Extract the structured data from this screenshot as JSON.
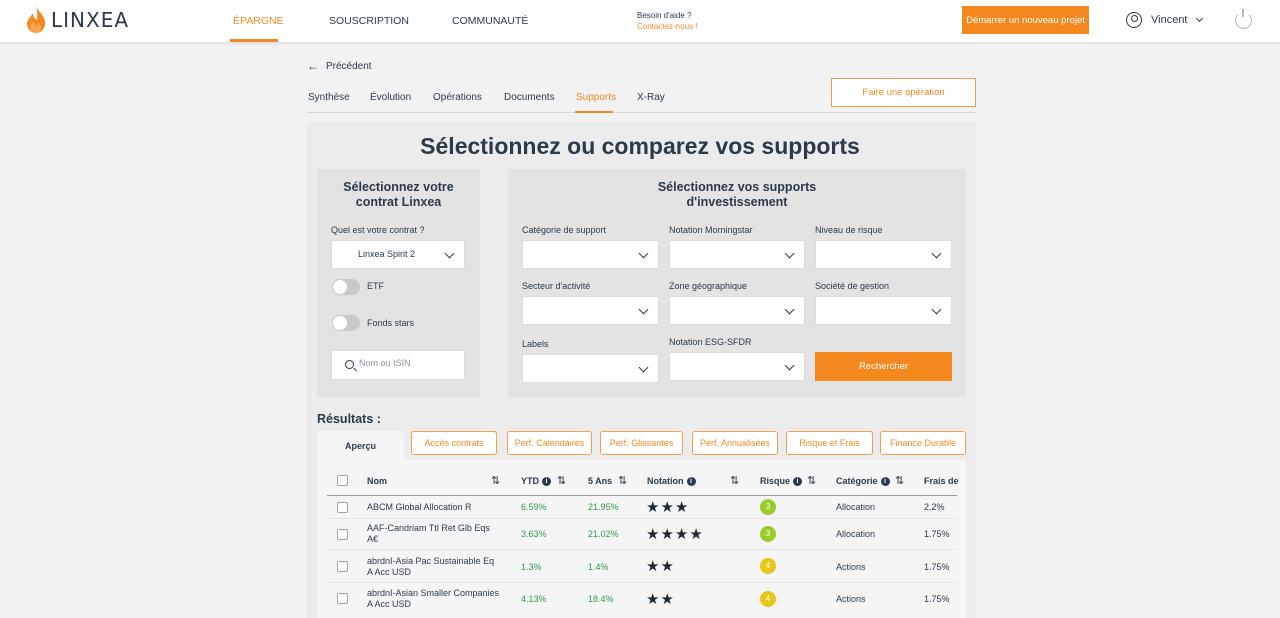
{
  "brand": {
    "name": "LINXEA",
    "accent": "#f5871f"
  },
  "topnav": {
    "items": [
      "ÉPARGNE",
      "SOUSCRIPTION",
      "COMMUNAUTÉ"
    ],
    "help_question": "Besoin d'aide ?",
    "help_contact": "Contactez-nous !",
    "new_project": "Démarrer un nouveau projet",
    "user_name": "Vincent"
  },
  "subnav": {
    "back": "Précédent",
    "tabs": [
      "Synthèse",
      "Évolution",
      "Opérations",
      "Documents",
      "Supports",
      "X-Ray"
    ],
    "active_tab": "Supports",
    "operation_button": "Faire une opération"
  },
  "page_title": "Sélectionnez ou comparez vos supports",
  "left_panel": {
    "title_line1": "Sélectionnez votre",
    "title_line2": "contrat Linxea",
    "contract_label": "Quel est votre contrat ?",
    "contract_value": "Linxea Spirit 2",
    "toggle_etf": "ETF",
    "toggle_stars": "Fonds stars",
    "search_placeholder": "Nom ou ISIN"
  },
  "right_panel": {
    "title_line1": "Sélectionnez vos supports",
    "title_line2": "d'investissement",
    "filters": [
      "Catégorie de support",
      "Notation Morningstar",
      "Niveau de risque",
      "Secteur d'activité",
      "Zone géographique",
      "Société de gestion",
      "Labels",
      "Notation ESG-SFDR"
    ],
    "search_button": "Rechercher"
  },
  "results": {
    "title": "Résultats :",
    "tabs": [
      "Aperçu",
      "Accès contrats",
      "Perf. Calendaires",
      "Perf. Glissantes",
      "Perf. Annualisées",
      "Risque et Frais",
      "Finance Durable"
    ],
    "columns": [
      "Nom",
      "YTD",
      "5 Ans",
      "Notation",
      "Risque",
      "Catégorie",
      "Frais de"
    ],
    "rows": [
      {
        "name1": "ABCM Global Allocation R",
        "name2": "",
        "ytd": "6.59%",
        "y5": "21.95%",
        "stars": "★★★",
        "risk": "3",
        "category": "Allocation",
        "fees": "2.2%"
      },
      {
        "name1": "AAF-Candriam Ttl Ret Glb Eqs",
        "name2": "A€",
        "ytd": "3.63%",
        "y5": "21.02%",
        "stars": "★★★★",
        "risk": "3",
        "category": "Allocation",
        "fees": "1.75%"
      },
      {
        "name1": "abrdnI-Asia Pac Sustainable Eq",
        "name2": "A Acc USD",
        "ytd": "1.3%",
        "y5": "1.4%",
        "stars": "★★",
        "risk": "4",
        "category": "Actions",
        "fees": "1.75%"
      },
      {
        "name1": "abrdnI-Asian Smaller Companies",
        "name2": "A Acc USD",
        "ytd": "4.13%",
        "y5": "18.4%",
        "stars": "★★",
        "risk": "4",
        "category": "Actions",
        "fees": "1.75%"
      }
    ],
    "risk_colors": {
      "3": "#9ccc2a",
      "4": "#e6c619"
    }
  }
}
